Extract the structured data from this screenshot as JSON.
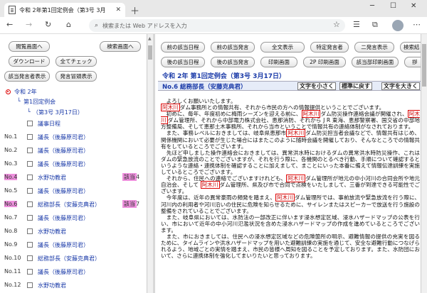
{
  "browser": {
    "tab_title": "令和 2年第1回定例会（第3号 3月",
    "address_placeholder": "検索または Web アドレスを入力"
  },
  "left": {
    "buttons": {
      "close": "閲覧画面へ",
      "search": "検索画面へ",
      "download": "ダウンロード",
      "check_all": "全てチェック",
      "speaker_list": "該当発言者表示",
      "speech_list": "発言冒頭表示"
    },
    "tree": {
      "year": "令和 2年",
      "session": "第1回定例会",
      "issue": "（第3号 3月17日）",
      "agenda": "議事日程"
    },
    "rows": [
      {
        "no": "No.1",
        "speaker": "議長（後藤原司君）",
        "badge": "",
        "count": ""
      },
      {
        "no": "No.2",
        "speaker": "議長（後藤原司君）",
        "badge": "",
        "count": ""
      },
      {
        "no": "No.3",
        "speaker": "議長（後藤原司君）",
        "badge": "",
        "count": ""
      },
      {
        "no": "No.4",
        "speaker": "水野功教君",
        "badge": "該当",
        "count": "4"
      },
      {
        "no": "No.5",
        "speaker": "議長（後藤原司君）",
        "badge": "",
        "count": ""
      },
      {
        "no": "No.6",
        "speaker": "総務部長（安藤克典君）",
        "badge": "該当",
        "count": "7"
      },
      {
        "no": "No.7",
        "speaker": "議長（後藤原司君）",
        "badge": "",
        "count": ""
      },
      {
        "no": "No.8",
        "speaker": "水野功教君",
        "badge": "",
        "count": ""
      },
      {
        "no": "No.9",
        "speaker": "議長（後藤原司君）",
        "badge": "",
        "count": ""
      },
      {
        "no": "No.10",
        "speaker": "総務部長（安藤克典君）",
        "badge": "",
        "count": ""
      },
      {
        "no": "No.11",
        "speaker": "議長（後藤原司君）",
        "badge": "",
        "count": ""
      },
      {
        "no": "No.12",
        "speaker": "水野功教君",
        "badge": "",
        "count": ""
      }
    ]
  },
  "right": {
    "toolbar1": [
      "前の該当日程",
      "前の該当発言",
      "全文表示",
      "特定発言者",
      "二発言表示",
      "検索結"
    ],
    "toolbar2": [
      "後の該当日程",
      "後の該当発言",
      "印刷画面",
      "2P 印刷画面",
      "該当部印刷画面",
      "拶"
    ],
    "session_title": "令和 2年 第1回定例会（第3号 3月17日）",
    "speaker_heading": "No.6 総務部長（安藤克典君）",
    "font_small": "文字を小さく",
    "font_reset": "標準に戻す",
    "font_large": "文字を大きく",
    "keyword": "阿木川",
    "paragraphs": [
      "　よろしくお願いいたします。",
      "KWダム事務所との情報共有、それから市民の方への情報提供ということでございます。",
      "　初めに、毎年、年度初めに梅雨シーズンを迎える前に、KWダム防災操作連絡会議が開催され、KWダム管理所、それから中部電力株式会社、恵那消防、それから J R 東海、恵那警察署、国交省の中部地方整備局、そして恵那土木事務所、それから当市ということで情報共有の連絡体制がなされております。",
      "　また、事務レベルにおきましては、岐阜県恵那市KWダム防災担当者会議などで、情報共有はじめ、関係機関において必要が生じた場合にはまたこのように随時会議を開催しており、そんなところでの情報共有をしているところでございます。",
      "　先ほど申しました操作連絡会におきましては、異常洪水時におけるダムの異常洪水時防災操作、これはダムの緊急放流のことでございますが、それを行う際に、各機関のとるべき行動、手順について確認するというような連絡・連携体制を確認することに加えまして、まことにいった本番に備えて情報伝達訓練を実施しているところでございます。",
      "　それから、住民への連絡でございますけれども、KWダム管理所が地元の中小河川の合同会所や地元自治会、そして KWダム管理所、県及び市で合同で点検をいたしまして、三番が到達できる可能性でございます。",
      "　今年度は、近年の異常豪雨の頻発を踏まえ、KWダム管理所では、事前放流や緊急放流を行う際に、河川内の利用者や河川沿いの住民に危険を知らせるために、サイレンまたはスピーカーで放送を行う施設の整備をされていることでございます。",
      "　また、岐阜県においては、水防法の一部改正に伴います浸水想定区域、浸水ハザードマップの公表を行い、市において近年の中小河川氾濫状況を含めた浸水ハザードマップの作成を進めているところでございます。",
      "　また、市におきましては、住民への浸水想定区域などの危険箇所の明示、避難情報の提供の充実を図るために、タイムラインや洪水ハザードマップを用いた避難訓練の実施を通じて、安全な避難行動につなげられるよう、地域ごとの実情を踏まえ、市民の皆様へ周知を図ることを予定しております。また、水防団において、さらに連携体制を強化してまいりたいと思っております。"
    ]
  }
}
